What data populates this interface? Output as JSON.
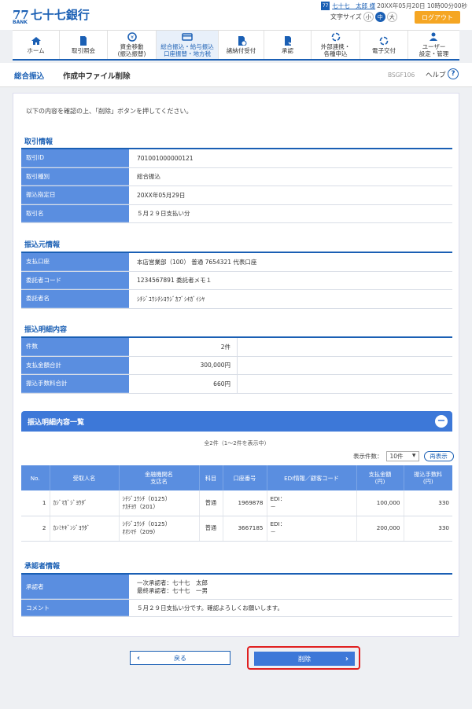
{
  "header": {
    "logo_mark": "77",
    "logo_sub": "BANK",
    "bank_name": "七十七銀行",
    "user_icon": "77",
    "user_name": "七十七　太郎 様",
    "login_time": "20XX年05月20日 10時00分00秒",
    "font_size_label": "文字サイズ",
    "font_sizes": [
      "小",
      "中",
      "大"
    ],
    "logout_label": "ログアウト"
  },
  "nav": [
    {
      "label": "ホーム",
      "icon": "home-icon"
    },
    {
      "label": "取引照会",
      "icon": "document-icon"
    },
    {
      "label": "資金移動\n(振込振替)",
      "icon": "yen-transfer-icon"
    },
    {
      "label": "総合振込・給与振込\n口座振替・地方税",
      "icon": "card-icon"
    },
    {
      "label": "諸納付受付",
      "icon": "payment-icon"
    },
    {
      "label": "承認",
      "icon": "approve-icon"
    },
    {
      "label": "外部連携・\n各種申込",
      "icon": "link-icon"
    },
    {
      "label": "電子交付",
      "icon": "electronic-icon"
    },
    {
      "label": "ユーザー\n設定・管理",
      "icon": "user-settings-icon"
    }
  ],
  "titlebar": {
    "category": "総合振込",
    "title": "作成中ファイル削除",
    "screen_code": "BSGF106",
    "help_label": "ヘルプ",
    "help_icon": "?"
  },
  "intro": "以下の内容を確認の上、「削除」ボタンを押してください。",
  "torihiki": {
    "title": "取引情報",
    "rows": [
      {
        "label": "取引ID",
        "value": "701001000000121"
      },
      {
        "label": "取引種別",
        "value": "総合振込"
      },
      {
        "label": "振込指定日",
        "value": "20XX年05月29日"
      },
      {
        "label": "取引名",
        "value": "５月２９日支払い分"
      }
    ]
  },
  "furikomimoto": {
    "title": "振込元情報",
    "rows": [
      {
        "label": "支払口座",
        "value": "本店営業部（100） 普通 7654321 代表口座"
      },
      {
        "label": "委託者コード",
        "value": "1234567891 委託者メモ１"
      },
      {
        "label": "委託者名",
        "value": "ｼﾁｼﾞﾕｳｼﾁｼﾖｳｼﾞｶﾌﾞｼｷｶﾞｲｼﾔ"
      }
    ]
  },
  "meisai": {
    "title": "振込明細内容",
    "rows": [
      {
        "label": "件数",
        "value": "2件"
      },
      {
        "label": "支払金額合計",
        "value": "300,000円"
      },
      {
        "label": "振込手数料合計",
        "value": "660円"
      }
    ]
  },
  "list": {
    "title": "振込明細内容一覧",
    "collapse_icon": "−",
    "count_text": "全2件（1～2件を表示中）",
    "per_page_label": "表示件数：",
    "per_page_value": "10件",
    "redisplay_label": "再表示",
    "headers": [
      "No.",
      "受取人名",
      "金融機関名\n支店名",
      "科目",
      "口座番号",
      "EDI情報／顧客コード",
      "支払金額\n(円)",
      "振込手数料\n(円)"
    ],
    "rows": [
      {
        "no": "1",
        "name": "ｶｼﾞﾏｶﾞｼﾞﾖｳﾀﾞ",
        "bank": "ｼﾁｼﾞﾕｳｼﾁ（0125）",
        "branch": "ﾅｶﾁﾖｳ（201）",
        "type": "普通",
        "account": "1969878",
        "edi1": "EDI：",
        "edi2": "－",
        "amount": "100,000",
        "fee": "330"
      },
      {
        "no": "2",
        "name": "ｶﾝﾐﾔｷﾞﾝｼﾞﾖｳﾀﾞ",
        "bank": "ｼﾁｼﾞﾕｳｼﾁ（0125）",
        "branch": "ｵｵｼﾏﾁ（209）",
        "type": "普通",
        "account": "3667185",
        "edi1": "EDI：",
        "edi2": "－",
        "amount": "200,000",
        "fee": "330"
      }
    ]
  },
  "approver": {
    "title": "承認者情報",
    "approver_label": "承認者",
    "approver_line1": "一次承認者：七十七　太郎",
    "approver_line2": "最終承認者：七十七　一男",
    "comment_label": "コメント",
    "comment_value": "５月２９日支払い分です。確認よろしくお願いします。"
  },
  "buttons": {
    "back_label": "戻る",
    "delete_label": "削除"
  }
}
